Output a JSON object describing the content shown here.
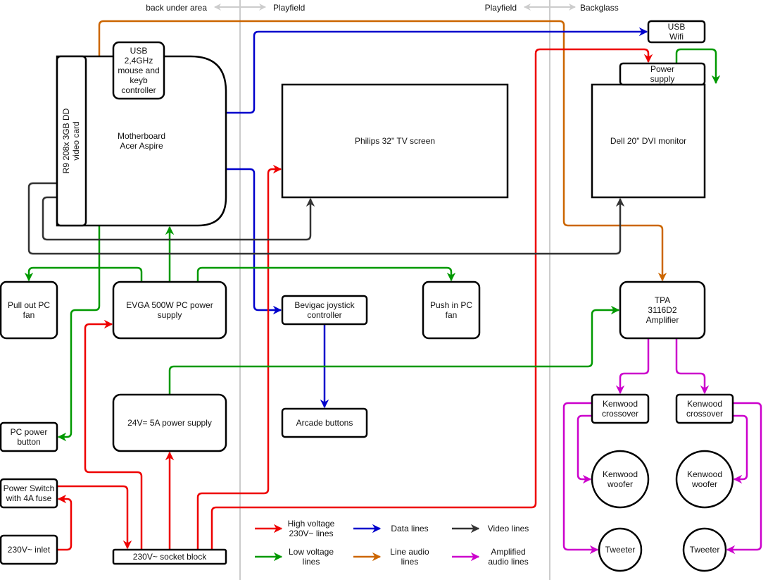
{
  "zones": {
    "left_label": "back under area",
    "mid_label_left": "Playfield",
    "mid_label_right": "Playfield",
    "right_label": "Backglass"
  },
  "colors": {
    "high_voltage": "#ee0000",
    "data": "#0000cc",
    "video": "#333333",
    "low_voltage": "#009900",
    "line_audio": "#cc6600",
    "amplified_audio": "#cc00cc",
    "zone_divider": "#cccccc"
  },
  "nodes": {
    "video_card": [
      "R9 208x 3GB DD",
      "video card"
    ],
    "motherboard": [
      "Motherboard",
      "Acer Aspire"
    ],
    "usb_controller": [
      "USB",
      "2,4GHz",
      "mouse and",
      "keyb",
      "controller"
    ],
    "usb_wifi": [
      "USB",
      "Wifi"
    ],
    "tv_screen": [
      "Philips 32\" TV screen"
    ],
    "monitor_psu": [
      "Power",
      "supply"
    ],
    "dell_monitor": [
      "Dell 20\" DVI monitor"
    ],
    "pull_out_fan": [
      "Pull out PC",
      "fan"
    ],
    "evga_psu": [
      "EVGA 500W PC power",
      "supply"
    ],
    "joystick_controller": [
      "Bevigac joystick",
      "controller"
    ],
    "push_in_fan": [
      "Push in PC",
      "fan"
    ],
    "amplifier": [
      "TPA",
      "3116D2",
      "Amplifier"
    ],
    "psu_24v": [
      "24V= 5A power supply"
    ],
    "arcade_buttons": [
      "Arcade buttons"
    ],
    "pc_power_button": [
      "PC power",
      "button"
    ],
    "power_switch": [
      "Power Switch",
      "with 4A fuse"
    ],
    "inlet": [
      "230V~ inlet"
    ],
    "socket_block": [
      "230V~ socket block"
    ],
    "crossover_left": [
      "Kenwood",
      "crossover"
    ],
    "crossover_right": [
      "Kenwood",
      "crossover"
    ],
    "woofer_left": [
      "Kenwood",
      "woofer"
    ],
    "woofer_right": [
      "Kenwood",
      "woofer"
    ],
    "tweeter_left": [
      "Tweeter"
    ],
    "tweeter_right": [
      "Tweeter"
    ]
  },
  "legend": [
    {
      "key": "high_voltage",
      "label": [
        "High voltage",
        "230V~ lines"
      ]
    },
    {
      "key": "data",
      "label": [
        "Data lines"
      ]
    },
    {
      "key": "video",
      "label": [
        "Video lines"
      ]
    },
    {
      "key": "low_voltage",
      "label": [
        "Low voltage",
        "lines"
      ]
    },
    {
      "key": "line_audio",
      "label": [
        "Line audio",
        "lines"
      ]
    },
    {
      "key": "amplified_audio",
      "label": [
        "Amplified",
        "audio lines"
      ]
    }
  ]
}
